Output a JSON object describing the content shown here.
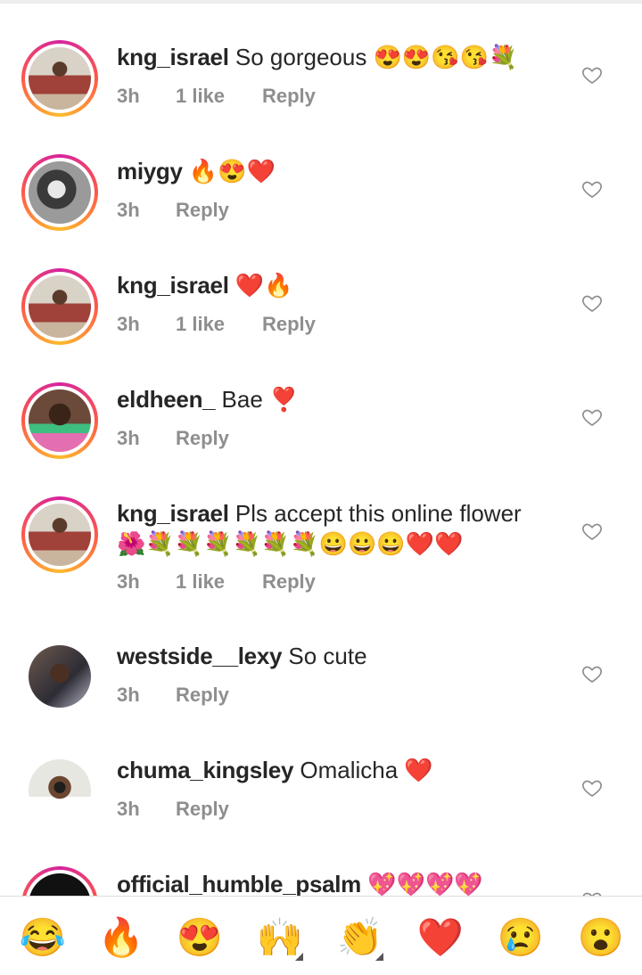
{
  "comments": [
    {
      "username": "kng_israel",
      "text": "So gorgeous 😍😍😘😘💐",
      "time": "3h",
      "likes": "1 like",
      "reply": "Reply"
    },
    {
      "username": "miygy",
      "text": "🔥😍❤️",
      "time": "3h",
      "likes": "",
      "reply": "Reply"
    },
    {
      "username": "kng_israel",
      "text": "❤️🔥",
      "time": "3h",
      "likes": "1 like",
      "reply": "Reply"
    },
    {
      "username": "eldheen_",
      "text": "Bae ❣️",
      "time": "3h",
      "likes": "",
      "reply": "Reply"
    },
    {
      "username": "kng_israel",
      "text": "Pls accept this online flower 🌺💐💐💐💐💐💐😀😀😀❤️❤️",
      "time": "3h",
      "likes": "1 like",
      "reply": "Reply"
    },
    {
      "username": "westside__lexy",
      "text": "So cute",
      "time": "3h",
      "likes": "",
      "reply": "Reply"
    },
    {
      "username": "chuma_kingsley",
      "text": "Omalicha ❤️",
      "time": "3h",
      "likes": "",
      "reply": "Reply"
    },
    {
      "username": "official_humble_psalm",
      "text": "💖💖💖💖",
      "time": "",
      "likes": "",
      "reply": ""
    }
  ],
  "emoji_bar": [
    "😂",
    "🔥",
    "😍",
    "🙌",
    "👏",
    "❤️",
    "😢",
    "😮"
  ],
  "icons": {
    "like": "heart-outline-icon"
  },
  "colors": {
    "text": "#262626",
    "meta": "#8e8e8e",
    "ring_start": "#d6249f",
    "ring_end": "#fdbb2d"
  }
}
